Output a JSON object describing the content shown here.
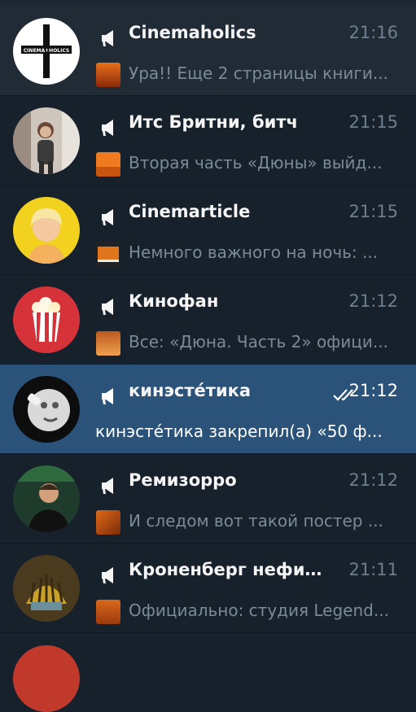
{
  "chats": [
    {
      "title": "Cinemaholics",
      "time": "21:16",
      "preview": "Ура!! Еще 2 страницы книги...",
      "avatar": "cinemaholics-logo",
      "logo_text": "CINEMA✝HOLICS"
    },
    {
      "title": "Итс Бритни, битч",
      "time": "21:15",
      "preview": "Вторая часть «Дюны» выйд...",
      "avatar": "photo-girl"
    },
    {
      "title": "Cinemarticle",
      "time": "21:15",
      "preview": "Немного важного на ночь: ...",
      "avatar": "yellow-illustration"
    },
    {
      "title": "Кинофан",
      "time": "21:12",
      "preview": "Все: «Дюна. Часть 2» офици...",
      "avatar": "popcorn"
    },
    {
      "title": "кинэсте́тика",
      "time": "21:12",
      "preview": "кинэсте́тика закрепил(а) «50 ф...",
      "avatar": "moon-rocket",
      "read": true
    },
    {
      "title": "Ремизорро",
      "time": "21:12",
      "preview": "И следом вот такой постер ...",
      "avatar": "photo-man"
    },
    {
      "title": "Кроненберг нефиль...",
      "time": "21:11",
      "preview": "Официально: студия Legend...",
      "avatar": "decorative-logo"
    }
  ]
}
